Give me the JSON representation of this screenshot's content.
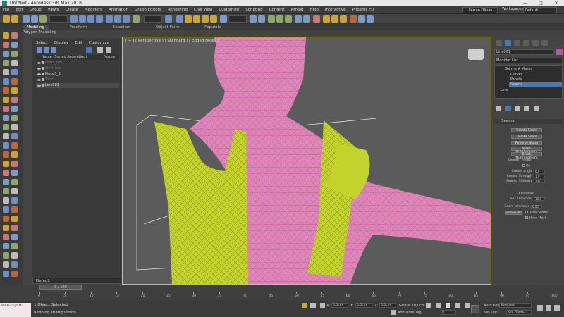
{
  "window": {
    "title": "Untitled - Autodesk 3ds Max 2018"
  },
  "menubar": {
    "items": [
      "File",
      "Edit",
      "Group",
      "Views",
      "Create",
      "Modifiers",
      "Animation",
      "Graph Editors",
      "Rendering",
      "Civil View",
      "Customize",
      "Scripting",
      "Content",
      "Arnold",
      "Help",
      "Interactive",
      "Phoenix FD"
    ],
    "user": "Ferran Olivan",
    "workspace_label": "Workspaces:",
    "workspace_value": "Default"
  },
  "ribbon": {
    "tabs": [
      "Modeling",
      "Freeform",
      "Selection",
      "Object Paint",
      "Populate"
    ],
    "active_tab": "Modeling",
    "subtitle": "Polygon Modeling"
  },
  "scene_explorer": {
    "tabs": [
      "Select",
      "Display",
      "Edit",
      "Customize"
    ],
    "header": "Name (Sorted Ascending)",
    "frozen_header": "Frozen",
    "rows": [
      {
        "name": "Arms_sim",
        "dim": true
      },
      {
        "name": "Skirt_top",
        "dim": true
      },
      {
        "name": "Piece5_2",
        "dim": false
      },
      {
        "name": "Torso",
        "dim": true
      },
      {
        "name": "Line001",
        "dim": false
      }
    ]
  },
  "layer": {
    "name": "Default",
    "frame": "0 / 100"
  },
  "viewport": {
    "label": "[ + ] [ Perspective ] [ Standard ] [ Edged Faces ]",
    "accent": "#d4c84a",
    "garment_color": "#c4d22e",
    "mesh_color": "#d94fb5"
  },
  "command_panel": {
    "object_name": "Line001",
    "modifier_list": "Modifier List",
    "stack": {
      "top": "Garment Maker",
      "children": [
        "Curves",
        "Panels",
        "Seams"
      ],
      "selected": "Seams",
      "base": "Line"
    },
    "rollout_title": "Seams",
    "buttons": [
      "Create Seam",
      "Delete Seam",
      "Reverse Seam",
      "Make MultiSegment",
      "Break MultiSegment"
    ],
    "length_label": "Length: (seam)",
    "on_label": "On",
    "params": [
      {
        "label": "Crease angle",
        "value": "0,0"
      },
      {
        "label": "Crease Strength",
        "value": "1,0"
      },
      {
        "label": "Sewing Stiffness",
        "value": "20,0"
      }
    ],
    "tearable_label": "Tearable",
    "tear_threshold": {
      "label": "Tear Threshold",
      "value": "10,0"
    },
    "seam_tolerance": {
      "label": "Seam tolerance",
      "value": "0,00"
    },
    "resew_all": "Resew All",
    "draw_seams": "Draw Seams",
    "show_mesh": "Show Mesh"
  },
  "timeline": {
    "ticks": [
      "0",
      "5",
      "10",
      "15",
      "20",
      "25",
      "30",
      "35",
      "40",
      "45",
      "50",
      "55",
      "60",
      "65",
      "70",
      "75",
      "80",
      "85",
      "90",
      "95",
      "100"
    ]
  },
  "status": {
    "thumb_text": "MAXScript Mi",
    "selection": "1 Object Selected",
    "refining": "Refining Triangulation",
    "x_label": "X:",
    "x_value": "0,0cm",
    "y_label": "Y:",
    "y_value": "0,0cm",
    "z_label": "Z:",
    "z_value": "0,0cm",
    "grid": "Grid = 10,0cm",
    "add_time_tag": "Add Time Tag",
    "auto_key": "Auto Key",
    "selected": "Selected",
    "set_key": "Set Key",
    "key_filters": "Key Filters...",
    "frame_field": "0"
  }
}
